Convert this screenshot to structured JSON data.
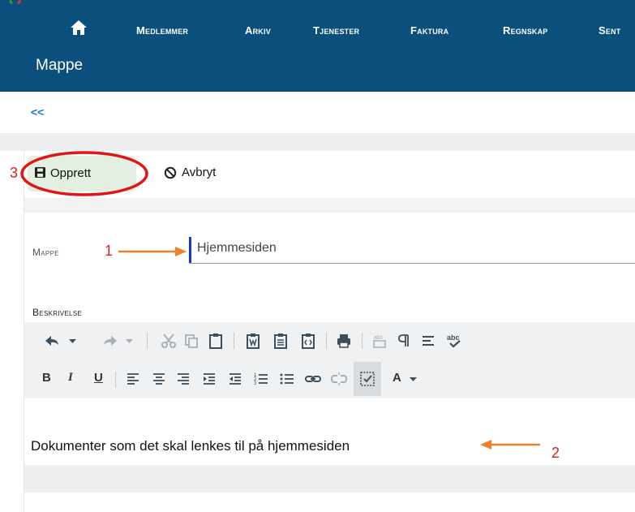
{
  "nav": {
    "items": [
      {
        "label": "Medlemmer"
      },
      {
        "label": "Arkiv"
      },
      {
        "label": "Tjenester"
      },
      {
        "label": "Faktura"
      },
      {
        "label": "Regnskap"
      },
      {
        "label": "Sent"
      }
    ]
  },
  "page": {
    "heading": "Mappe",
    "back_label": "<<"
  },
  "toolbar": {
    "create_label": "Opprett",
    "cancel_label": "Avbryt"
  },
  "form": {
    "mappe_label": "Mappe",
    "mappe_value": "Hjemmesiden",
    "beskrivelse_label": "Beskrivelse"
  },
  "editor": {
    "content": "Dokumenter som det skal lenkes til på hjemmesiden",
    "toolbar_text": {
      "bold": "B",
      "italic": "I",
      "underline": "U",
      "font_color": "A"
    }
  },
  "annotations": {
    "n1": "1",
    "n2": "2",
    "n3": "3"
  },
  "colors": {
    "topbar": "#0b4f7c",
    "link": "#1a73e8",
    "annotation_red": "#e02020",
    "annotation_orange": "#f07f2a",
    "create_button_bg": "#e3efe0"
  }
}
